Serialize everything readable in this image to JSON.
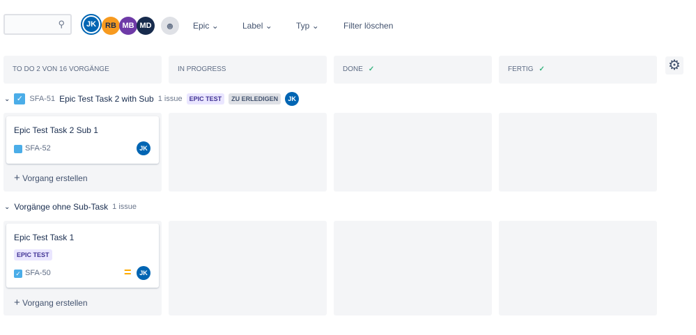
{
  "toolbar": {
    "search_placeholder": "",
    "avatars": [
      {
        "initials": "JK",
        "color": "#0065b3"
      },
      {
        "initials": "RB",
        "color": "#f79a1f"
      },
      {
        "initials": "MB",
        "color": "#6e3aa7"
      },
      {
        "initials": "MD",
        "color": "#172b4d"
      }
    ],
    "filters": [
      "Epic",
      "Label",
      "Typ"
    ],
    "clear": "Filter löschen"
  },
  "columns": [
    {
      "title": "TO DO 2 VON 16 VORGÄNGE",
      "done": false
    },
    {
      "title": "IN PROGRESS",
      "done": false
    },
    {
      "title": "DONE",
      "done": true
    },
    {
      "title": "FERTIG",
      "done": true
    }
  ],
  "check": "✓",
  "swimlanes": [
    {
      "key": "SFA-51",
      "title": "Epic Test Task 2 with Sub",
      "count": "1 issue",
      "epic": "EPIC TEST",
      "status": "ZU ERLEDIGEN",
      "assignee": "JK",
      "card": {
        "title": "Epic Test Task 2 Sub 1",
        "key": "SFA-52",
        "assignee": "JK"
      }
    },
    {
      "title": "Vorgänge ohne Sub-Task",
      "count": "1 issue",
      "card": {
        "title": "Epic Test Task 1",
        "epic": "EPIC TEST",
        "key": "SFA-50",
        "assignee": "JK"
      }
    }
  ],
  "create_label": "Vorgang erstellen",
  "colors": {
    "accent": "#0065b3",
    "epic_bg": "#eae6ff",
    "epic_fg": "#403294",
    "priority": "#ffab00"
  }
}
